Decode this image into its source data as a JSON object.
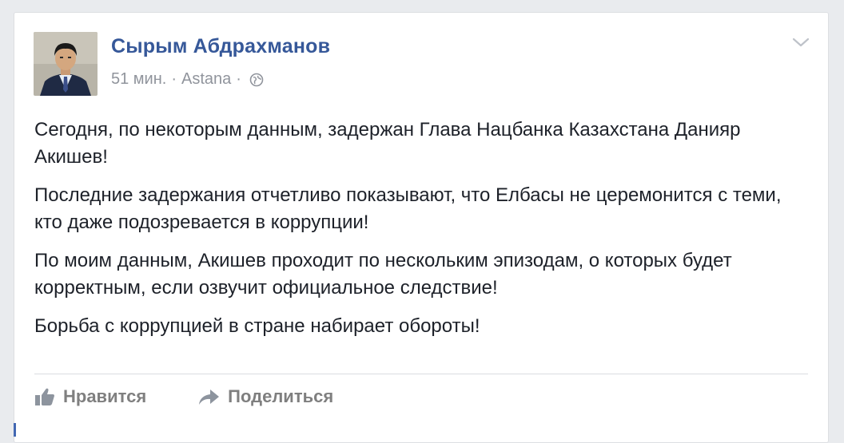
{
  "post": {
    "author_name": "Сырым Абдрахманов",
    "time": "51 мин.",
    "separator": "·",
    "location": "Astana",
    "privacy_icon": "globe-icon",
    "menu_icon": "chevron-down-icon",
    "paragraphs": [
      "Сегодня, по некоторым данным, задержан Глава Нацбанка Казахстана Данияр Акишев!",
      "Последние задержания отчетливо показывают, что Елбасы не церемонится с теми, кто даже подозревается в коррупции!",
      "По моим данным, Акишев проходит по нескольким эпизодам, о которых будет корректным, если озвучит официальное следствие!",
      "Борьба с коррупцией в стране набирает обороты!"
    ]
  },
  "actions": {
    "like_label": "Нравится",
    "like_icon": "thumbs-up-icon",
    "share_label": "Поделиться",
    "share_icon": "share-arrow-icon"
  },
  "colors": {
    "author_link": "#365899",
    "meta_text": "#90949c",
    "body_text": "#1d2129",
    "action_text": "#7f7f7f",
    "page_background": "#e9ebee"
  }
}
